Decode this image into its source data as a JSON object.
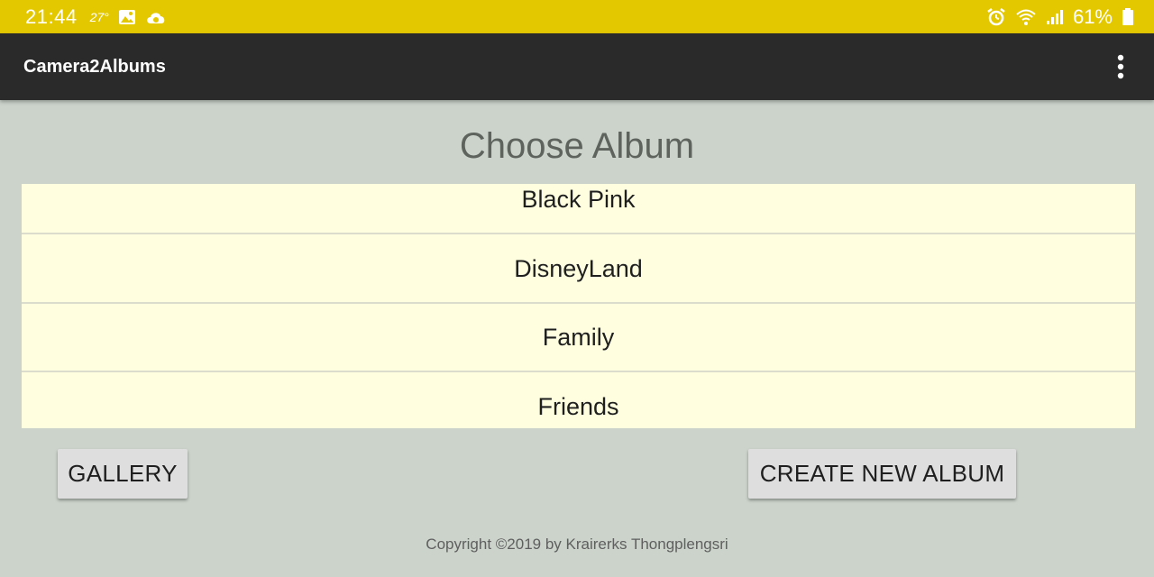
{
  "status_bar": {
    "time": "21:44",
    "temperature": "27°",
    "battery_percent": "61%",
    "icons": [
      "image-icon",
      "cloud-icon",
      "alarm-icon",
      "wifi-icon",
      "signal-icon",
      "battery-icon"
    ],
    "background_color": "#e3c800"
  },
  "app_bar": {
    "title": "Camera2Albums",
    "overflow_icon": "more-vert-icon",
    "background_color": "#2a2a2a"
  },
  "main": {
    "title": "Choose Album",
    "albums": [
      {
        "label": "Black Pink"
      },
      {
        "label": "DisneyLand"
      },
      {
        "label": "Family"
      },
      {
        "label": "Friends"
      }
    ],
    "list_background_color": "#ffffe0"
  },
  "buttons": {
    "gallery_label": "GALLERY",
    "create_label": "CREATE NEW ALBUM"
  },
  "footer": {
    "copyright": "Copyright ©2019 by Krairerks Thongplengsri"
  }
}
